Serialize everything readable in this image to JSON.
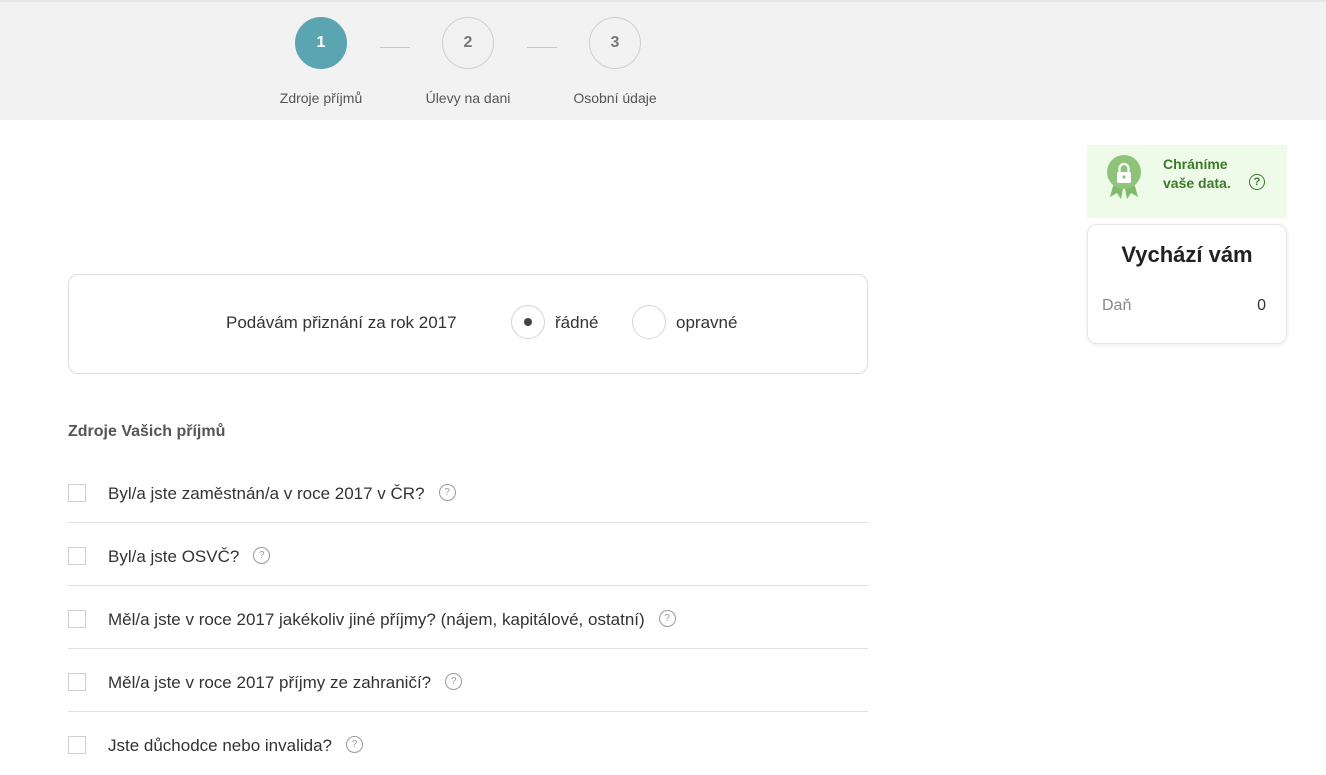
{
  "stepper": {
    "steps": [
      {
        "number": "1",
        "label": "Zdroje příjmů"
      },
      {
        "number": "2",
        "label": "Úlevy na dani"
      },
      {
        "number": "3",
        "label": "Osobní údaje"
      }
    ],
    "active_step": "1"
  },
  "protect": {
    "text": "Chráníme vaše data.",
    "help_icon": "question-icon"
  },
  "summary": {
    "title": "Vychází vám",
    "tax_label": "Daň",
    "tax_value": "0"
  },
  "filing": {
    "label": "Podávám přiznání za rok 2017",
    "options": [
      {
        "label": "řádné",
        "selected": true
      },
      {
        "label": "opravné",
        "selected": false
      }
    ]
  },
  "income": {
    "title": "Zdroje Vašich příjmů",
    "questions": [
      {
        "text": "Byl/a jste zaměstnán/a v roce 2017 v ČR?",
        "checked": false
      },
      {
        "text": "Byl/a jste OSVČ?",
        "checked": false
      },
      {
        "text": "Měl/a jste v roce 2017 jakékoliv jiné příjmy? (nájem, kapitálové, ostatní)",
        "checked": false
      },
      {
        "text": "Měl/a jste v roce 2017 příjmy ze zahraničí?",
        "checked": false
      },
      {
        "text": "Jste důchodce nebo invalida?",
        "checked": false
      }
    ],
    "help_glyph": "?"
  },
  "colors": {
    "accent": "#5aa5b1",
    "protect_bg": "#eefbe9",
    "protect_text": "#3c7a2a",
    "badge": "#7fba6b"
  }
}
